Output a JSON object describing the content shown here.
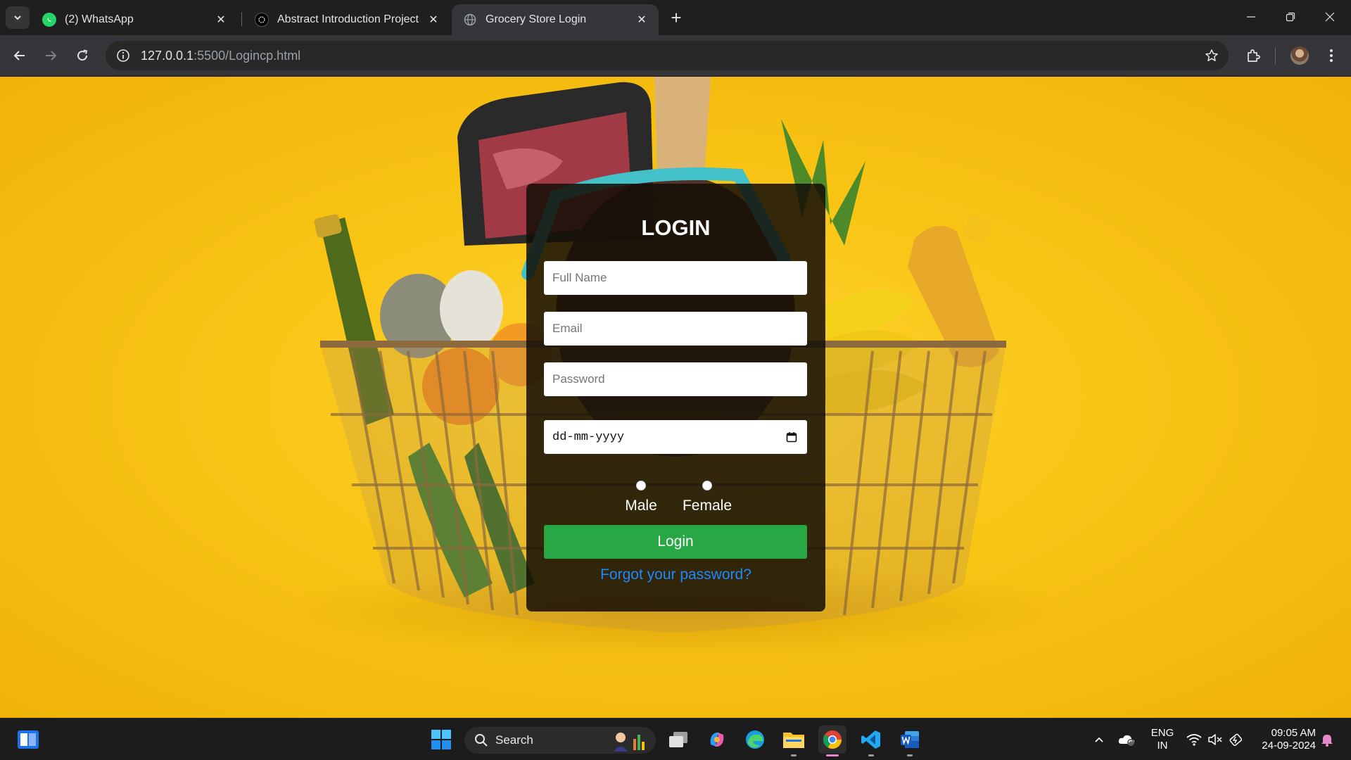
{
  "browser": {
    "tabs": [
      {
        "title": "(2) WhatsApp",
        "favicon": "whatsapp-icon",
        "active": false
      },
      {
        "title": "Abstract Introduction Project D",
        "favicon": "openai-icon",
        "active": false
      },
      {
        "title": "Grocery Store Login",
        "favicon": "globe-icon",
        "active": true
      }
    ],
    "url_host": "127.0.0.1",
    "url_path": ":5500/Logincp.html"
  },
  "login": {
    "title": "LOGIN",
    "full_name_placeholder": "Full Name",
    "email_placeholder": "Email",
    "password_placeholder": "Password",
    "date_value": "dd-mm-yyyy",
    "gender_options": [
      "Male",
      "Female"
    ],
    "login_button": "Login",
    "forgot_link": "Forgot your password?",
    "colors": {
      "button": "#28a745",
      "link": "#1e88ff",
      "background": "#f9c515"
    }
  },
  "taskbar": {
    "search_label": "Search",
    "language": [
      "ENG",
      "IN"
    ],
    "time": "09:05 AM",
    "date": "24-09-2024"
  }
}
